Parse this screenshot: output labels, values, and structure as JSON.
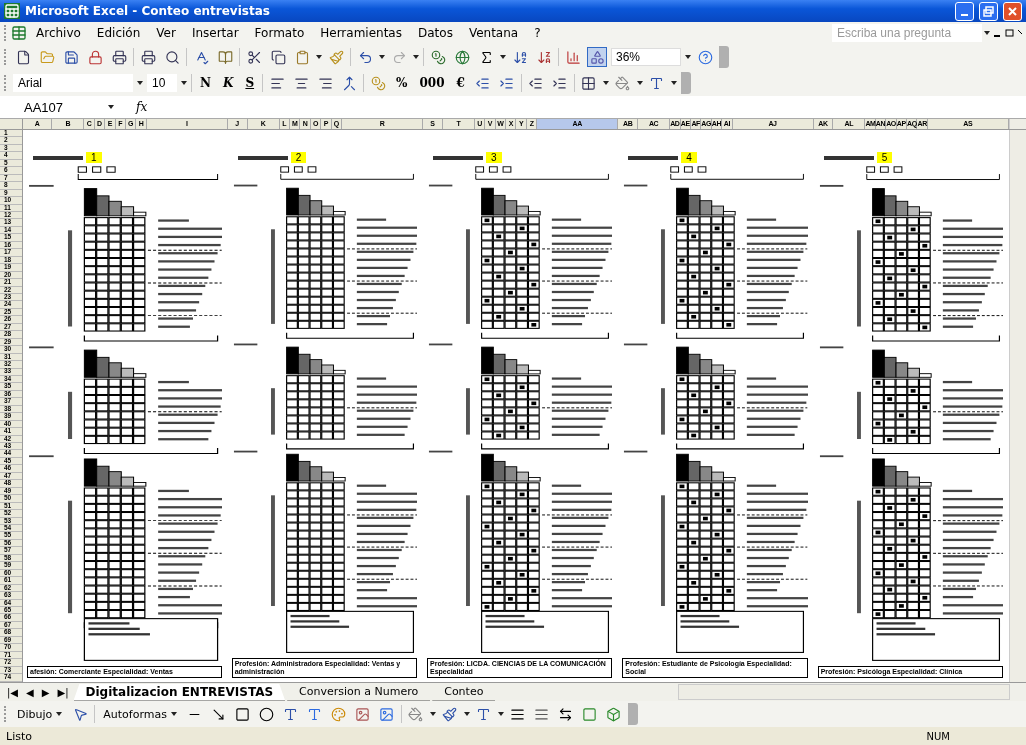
{
  "window": {
    "title": "Microsoft Excel - Conteo entrevistas"
  },
  "menu": [
    {
      "label": "Archivo"
    },
    {
      "label": "Edición"
    },
    {
      "label": "Ver"
    },
    {
      "label": "Insertar"
    },
    {
      "label": "Formato"
    },
    {
      "label": "Herramientas"
    },
    {
      "label": "Datos"
    },
    {
      "label": "Ventana"
    },
    {
      "label": "?"
    }
  ],
  "help_box": {
    "placeholder": "Escriba una pregunta"
  },
  "zoom_box": {
    "value": "36%"
  },
  "font_box": {
    "value": "Arial"
  },
  "size_box": {
    "value": "10"
  },
  "style_buttons": [
    {
      "label": "N",
      "kind": "bold"
    },
    {
      "label": "K",
      "kind": "italic"
    },
    {
      "label": "S",
      "kind": "underline"
    }
  ],
  "number_buttons": [
    {
      "label": "%"
    },
    {
      "label": "000"
    },
    {
      "label": "€"
    }
  ],
  "name_box": {
    "value": "AA107"
  },
  "formula_label": "fx",
  "columns": [
    {
      "label": "A",
      "selected": false
    },
    {
      "label": "B",
      "selected": false
    },
    {
      "label": "C",
      "selected": false
    },
    {
      "label": "D",
      "selected": false
    },
    {
      "label": "E",
      "selected": false
    },
    {
      "label": "F",
      "selected": false
    },
    {
      "label": "G",
      "selected": false
    },
    {
      "label": "H",
      "selected": false
    },
    {
      "label": "I",
      "selected": false
    },
    {
      "label": "J",
      "selected": false
    },
    {
      "label": "K",
      "selected": false
    },
    {
      "label": "L",
      "selected": false
    },
    {
      "label": "M",
      "selected": false
    },
    {
      "label": "N",
      "selected": false
    },
    {
      "label": "O",
      "selected": false
    },
    {
      "label": "P",
      "selected": false
    },
    {
      "label": "Q",
      "selected": false
    },
    {
      "label": "R",
      "selected": false
    },
    {
      "label": "S",
      "selected": false
    },
    {
      "label": "T",
      "selected": false
    },
    {
      "label": "U",
      "selected": false
    },
    {
      "label": "V",
      "selected": false
    },
    {
      "label": "W",
      "selected": false
    },
    {
      "label": "X",
      "selected": false
    },
    {
      "label": "Y",
      "selected": false
    },
    {
      "label": "Z",
      "selected": false
    },
    {
      "label": "AA",
      "selected": true
    },
    {
      "label": "AB",
      "selected": false
    },
    {
      "label": "AC",
      "selected": false
    },
    {
      "label": "AD",
      "selected": false
    },
    {
      "label": "AE",
      "selected": false
    },
    {
      "label": "AF",
      "selected": false
    },
    {
      "label": "AG",
      "selected": false
    },
    {
      "label": "AH",
      "selected": false
    },
    {
      "label": "AI",
      "selected": false
    },
    {
      "label": "AJ",
      "selected": false
    },
    {
      "label": "AK",
      "selected": false
    },
    {
      "label": "AL",
      "selected": false
    },
    {
      "label": "AM",
      "selected": false
    },
    {
      "label": "AN",
      "selected": false
    },
    {
      "label": "AO",
      "selected": false
    },
    {
      "label": "AP",
      "selected": false
    },
    {
      "label": "AQ",
      "selected": false
    },
    {
      "label": "AR",
      "selected": false
    },
    {
      "label": "AS",
      "selected": false
    }
  ],
  "rows": [
    "1",
    "2",
    "3",
    "4",
    "5",
    "6",
    "7",
    "8",
    "9",
    "10",
    "11",
    "12",
    "13",
    "14",
    "15",
    "16",
    "17",
    "18",
    "19",
    "20",
    "21",
    "22",
    "23",
    "24",
    "25",
    "26",
    "27",
    "28",
    "29",
    "30",
    "31",
    "32",
    "33",
    "34",
    "35",
    "36",
    "37",
    "38",
    "39",
    "40",
    "41",
    "42",
    "43",
    "44",
    "45",
    "46",
    "47",
    "48",
    "49",
    "50",
    "51",
    "52",
    "53",
    "54",
    "55",
    "56",
    "57",
    "58",
    "59",
    "60",
    "61",
    "62",
    "63",
    "64",
    "65",
    "66",
    "67",
    "68",
    "69",
    "70",
    "71",
    "72",
    "73",
    "74"
  ],
  "blocks": [
    {
      "number": "1",
      "marked": false,
      "profession": "afesión: Comerciante Especialidad: Ventas"
    },
    {
      "number": "2",
      "marked": false,
      "profession": "Profesión: Administradora Especialidad: Ventas y administración"
    },
    {
      "number": "3",
      "marked": true,
      "profession": "Profesión: LICDA. CIENCIAS DE LA COMUNICACIÓN Especialidad"
    },
    {
      "number": "4",
      "marked": true,
      "profession": "Profesión: Estudiante de Psicología Especialidad: Social"
    },
    {
      "number": "5",
      "marked": true,
      "profession": "Profesión: Psicóloga Especialidad: Clínica"
    }
  ],
  "sheet_nav": [
    {
      "label": "|◀"
    },
    {
      "label": "◀"
    },
    {
      "label": "▶"
    },
    {
      "label": "▶|"
    }
  ],
  "sheet_tabs": [
    {
      "label": "Digitalizacion ENTREVISTAS",
      "selected": true
    },
    {
      "label": "Conversion a Numero",
      "selected": false
    },
    {
      "label": "Conteo",
      "selected": false
    }
  ],
  "drawing_toolbar": {
    "draw_menu": "Dibujo",
    "shapes_menu": "Autoformas"
  },
  "status_bar": {
    "text": "Listo",
    "indicator": "NUM"
  }
}
